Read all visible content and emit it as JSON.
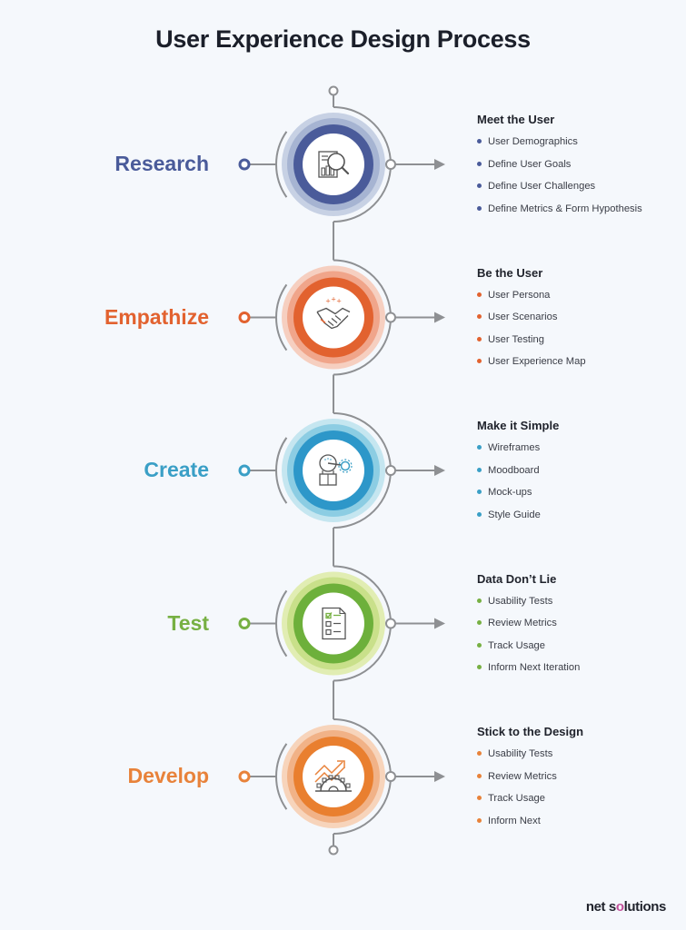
{
  "title": "User Experience Design Process",
  "brand": {
    "prefix": "net s",
    "accent": "o",
    "suffix": "lutions"
  },
  "connector_color": "#8e9093",
  "stages": [
    {
      "label": "Research",
      "icon": "analytics-magnifier-icon",
      "color": "#4a5b9a",
      "ring_colors": [
        "#c7d1e4",
        "#a6b4d2",
        "#4a5b9a"
      ],
      "heading": "Meet the User",
      "items": [
        "User Demographics",
        "Define User Goals",
        "Define User Challenges",
        "Define Metrics & Form Hypothesis"
      ]
    },
    {
      "label": "Empathize",
      "icon": "handshake-icon",
      "color": "#e2622f",
      "ring_colors": [
        "#f6cfc0",
        "#f0a58a",
        "#e2622f"
      ],
      "heading": "Be the User",
      "items": [
        "User Persona",
        "User Scenarios",
        "User Testing",
        "User Experience Map"
      ]
    },
    {
      "label": "Create",
      "icon": "lightbulb-gear-icon",
      "color": "#3a9fc6",
      "ring_colors": [
        "#c5e6f0",
        "#8ccde3",
        "#2d97c9"
      ],
      "heading": "Make it Simple",
      "items": [
        "Wireframes",
        "Moodboard",
        "Mock-ups",
        "Style Guide"
      ]
    },
    {
      "label": "Test",
      "icon": "checklist-document-icon",
      "color": "#77b043",
      "ring_colors": [
        "#e1edb3",
        "#c9e08a",
        "#6db03b"
      ],
      "heading": "Data Don’t Lie",
      "items": [
        "Usability Tests",
        "Review Metrics",
        "Track Usage",
        "Inform Next Iteration"
      ]
    },
    {
      "label": "Develop",
      "icon": "growth-gear-icon",
      "color": "#e8823a",
      "ring_colors": [
        "#f7d4bb",
        "#f1b287",
        "#e97f2f"
      ],
      "heading": "Stick to the Design",
      "items": [
        "Usability Tests",
        "Review Metrics",
        "Track Usage",
        "Inform Next"
      ]
    }
  ]
}
